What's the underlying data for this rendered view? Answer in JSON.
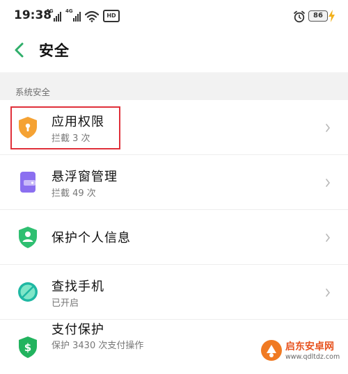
{
  "status_bar": {
    "time": "19:38",
    "signal_1_label": "4G",
    "signal_2_label": "4G",
    "hd_label": "HD",
    "battery": "86",
    "icons": [
      "signal-icon",
      "wifi-icon",
      "hd-icon",
      "alarm-icon",
      "battery-icon",
      "charging-icon"
    ]
  },
  "header": {
    "title": "安全",
    "back_icon": "back-arrow-icon"
  },
  "section": {
    "title": "系统安全"
  },
  "items": [
    {
      "name": "应用权限",
      "sub": "拦截 3 次",
      "icon": "shield-lock-icon",
      "color": "#f5a233"
    },
    {
      "name": "悬浮窗管理",
      "sub": "拦截 49 次",
      "icon": "floating-window-icon",
      "color": "#8b6ff0"
    },
    {
      "name": "保护个人信息",
      "sub": "",
      "icon": "user-shield-icon",
      "color": "#2fbf71"
    },
    {
      "name": "查找手机",
      "sub": "已开启",
      "icon": "find-phone-icon",
      "color": "#1fb8a3"
    },
    {
      "name": "支付保护",
      "sub": "保护 3430 次支付操作",
      "icon": "payment-shield-icon",
      "color": "#22b35e"
    }
  ],
  "highlight_color": "#e0303a",
  "watermark": {
    "line1": "启东安卓网",
    "line2": "www.qdltdz.com"
  }
}
